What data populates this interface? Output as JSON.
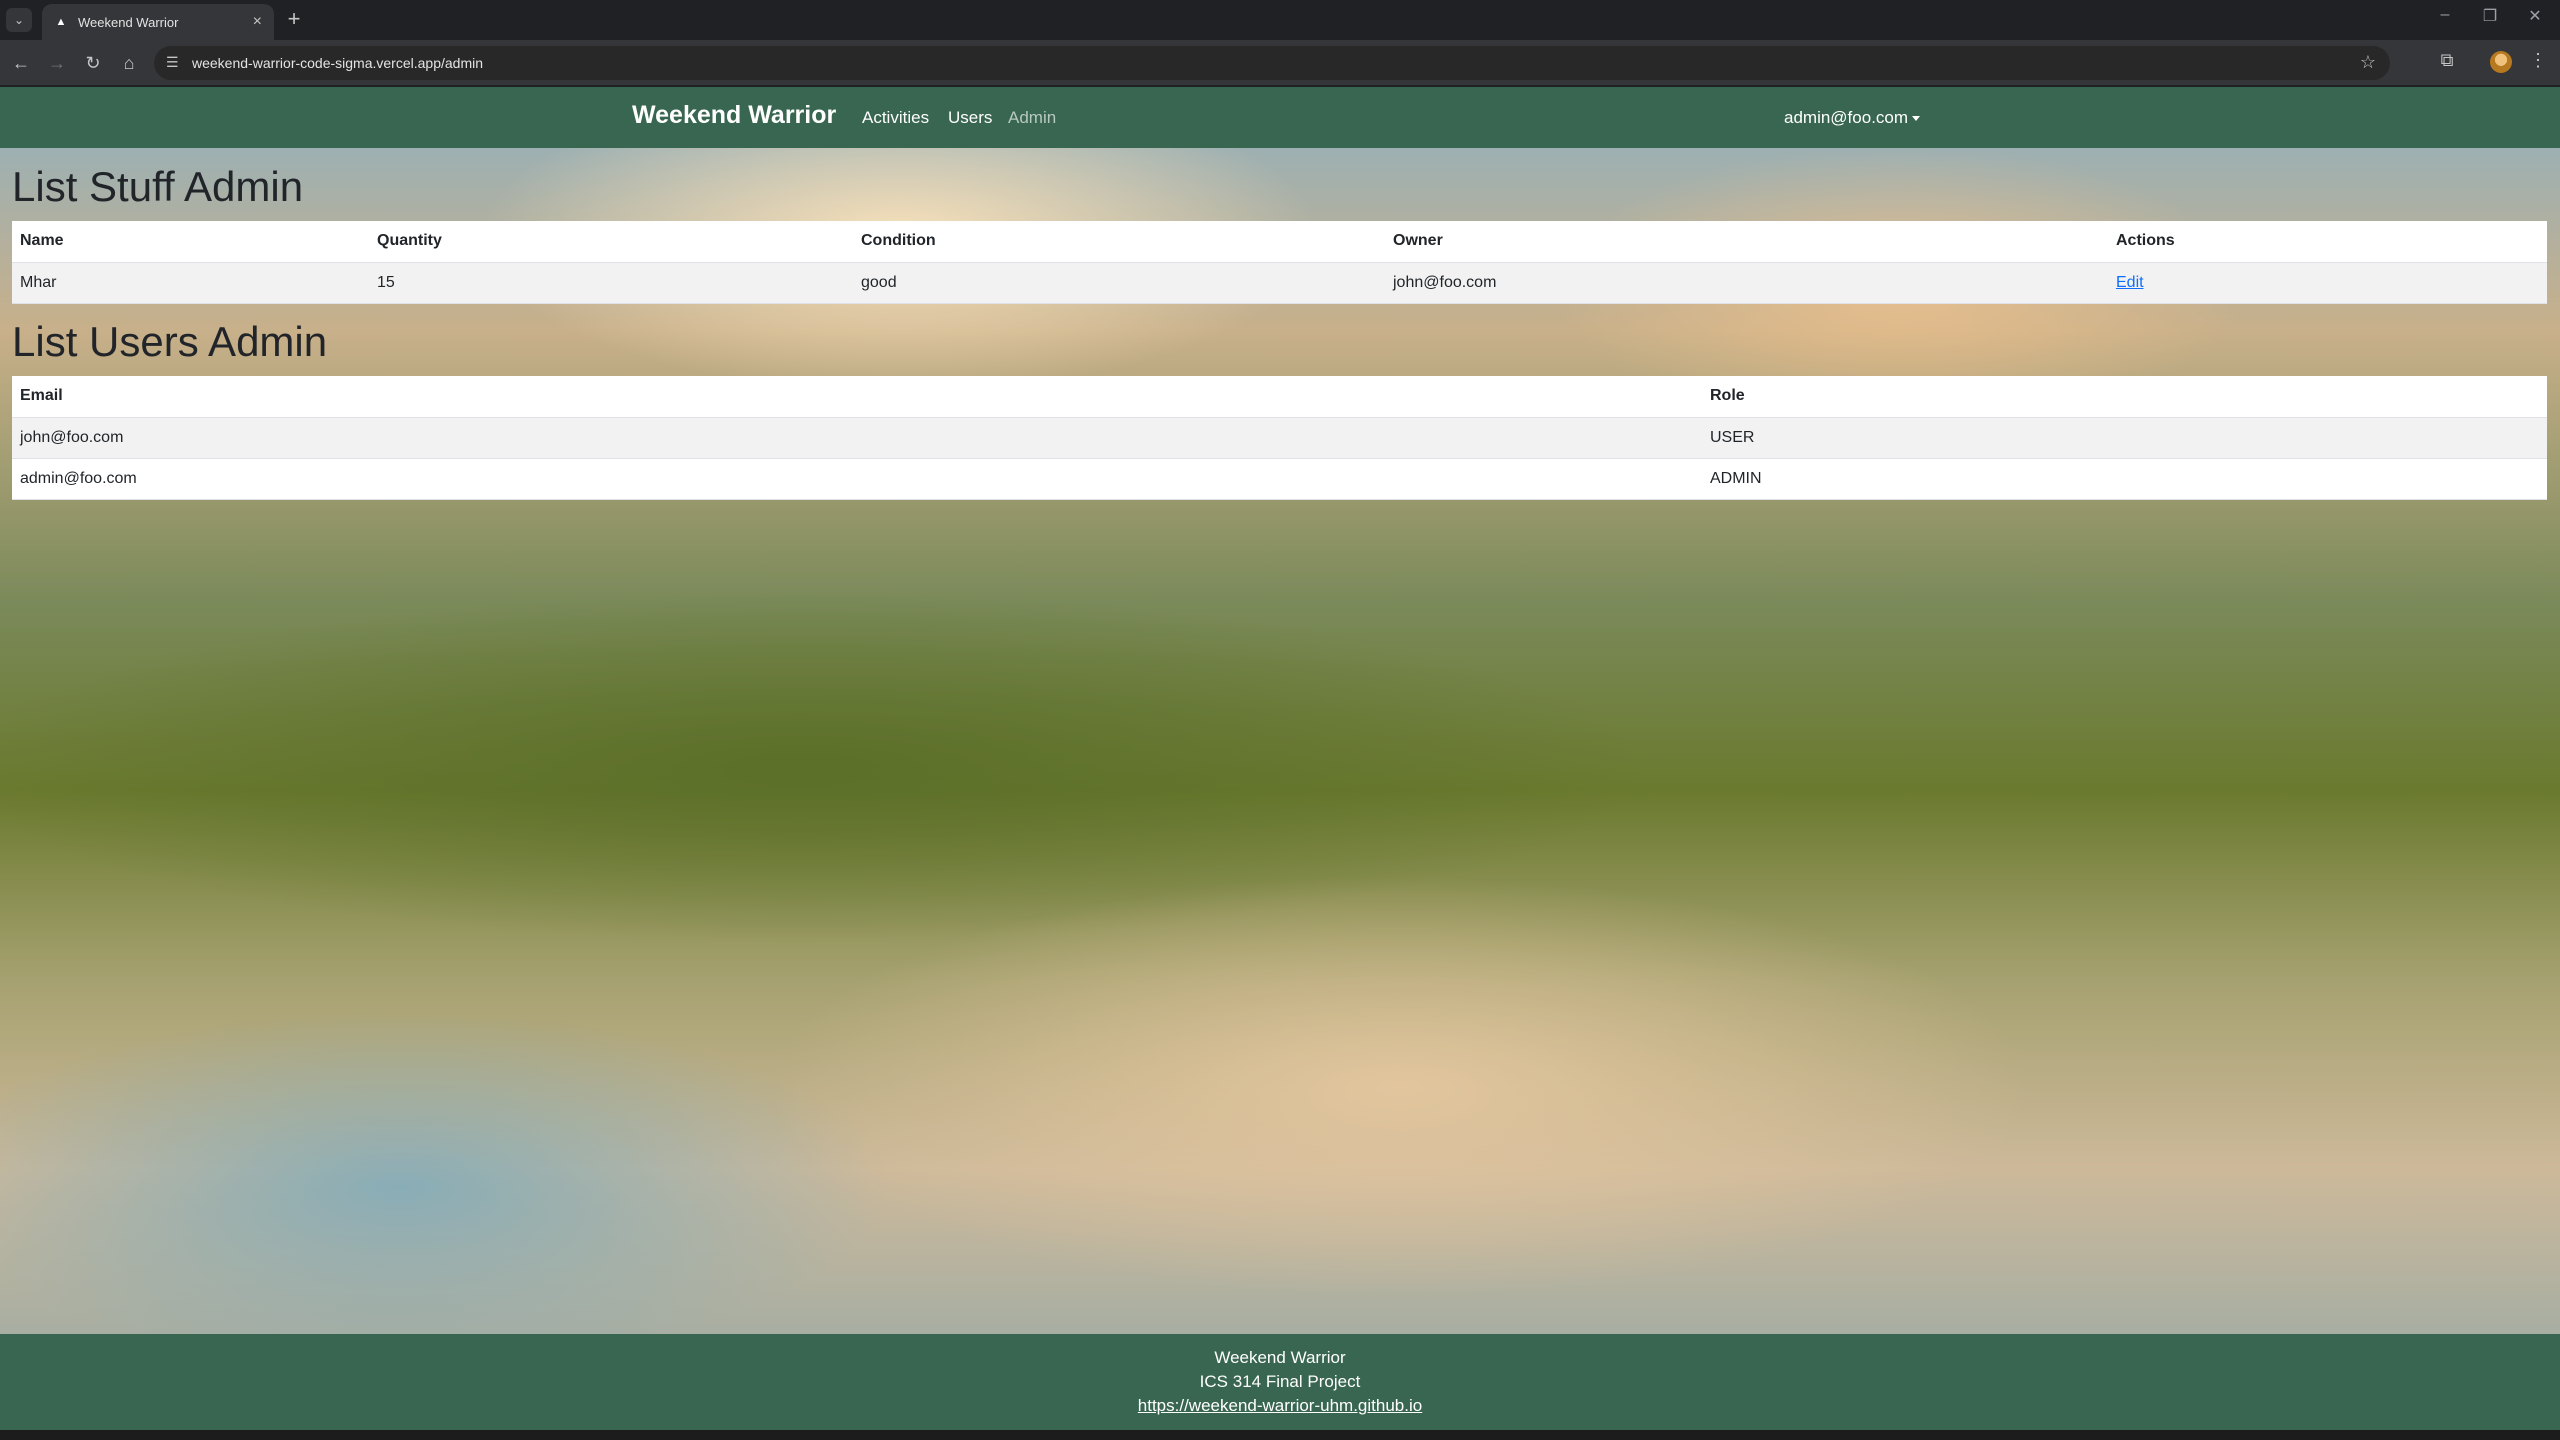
{
  "browser": {
    "tab_title": "Weekend Warrior",
    "url": "weekend-warrior-code-sigma.vercel.app/admin"
  },
  "navbar": {
    "brand": "Weekend Warrior",
    "links": [
      "Activities",
      "Users",
      "Admin"
    ],
    "user": "admin@foo.com"
  },
  "stuff": {
    "heading": "List Stuff Admin",
    "columns": [
      "Name",
      "Quantity",
      "Condition",
      "Owner",
      "Actions"
    ],
    "rows": [
      {
        "name": "Mhar",
        "quantity": "15",
        "condition": "good",
        "owner": "john@foo.com",
        "action": "Edit"
      }
    ]
  },
  "users": {
    "heading": "List Users Admin",
    "columns": [
      "Email",
      "Role"
    ],
    "rows": [
      {
        "email": "john@foo.com",
        "role": "USER"
      },
      {
        "email": "admin@foo.com",
        "role": "ADMIN"
      }
    ]
  },
  "footer": {
    "line1": "Weekend Warrior",
    "line2": "ICS 314 Final Project",
    "link": "https://weekend-warrior-uhm.github.io"
  },
  "colors": {
    "navbar": "#386650",
    "link": "#0d6efd"
  }
}
